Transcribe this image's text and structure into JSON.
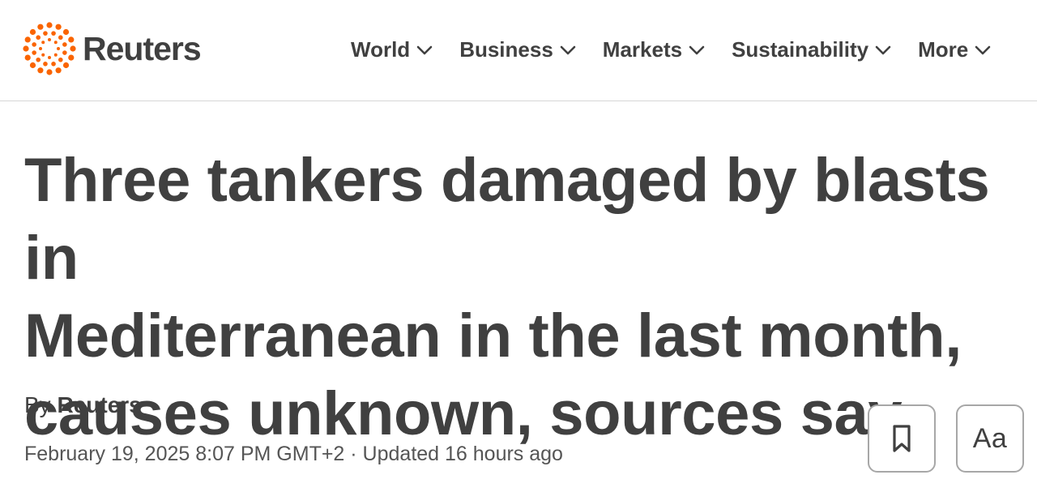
{
  "brand": {
    "name": "Reuters",
    "accent_color": "#fa6400",
    "text_color": "#404040"
  },
  "nav": {
    "items": [
      {
        "label": "World",
        "icon": "chevron-down-icon"
      },
      {
        "label": "Business",
        "icon": "chevron-down-icon"
      },
      {
        "label": "Markets",
        "icon": "chevron-down-icon"
      },
      {
        "label": "Sustainability",
        "icon": "chevron-down-icon"
      },
      {
        "label": "More",
        "icon": "chevron-down-icon"
      }
    ]
  },
  "article": {
    "headline_lines": [
      "Three tankers damaged by blasts in",
      "Mediterranean in the last month,",
      "causes unknown, sources say"
    ],
    "byline_prefix": "By",
    "byline_author": "Reuters",
    "dateline": "February 19, 2025 8:07 PM GMT+2 · Updated 16 hours ago"
  },
  "tools": {
    "bookmark_icon": "bookmark-icon",
    "font_size_label": "Aa"
  }
}
